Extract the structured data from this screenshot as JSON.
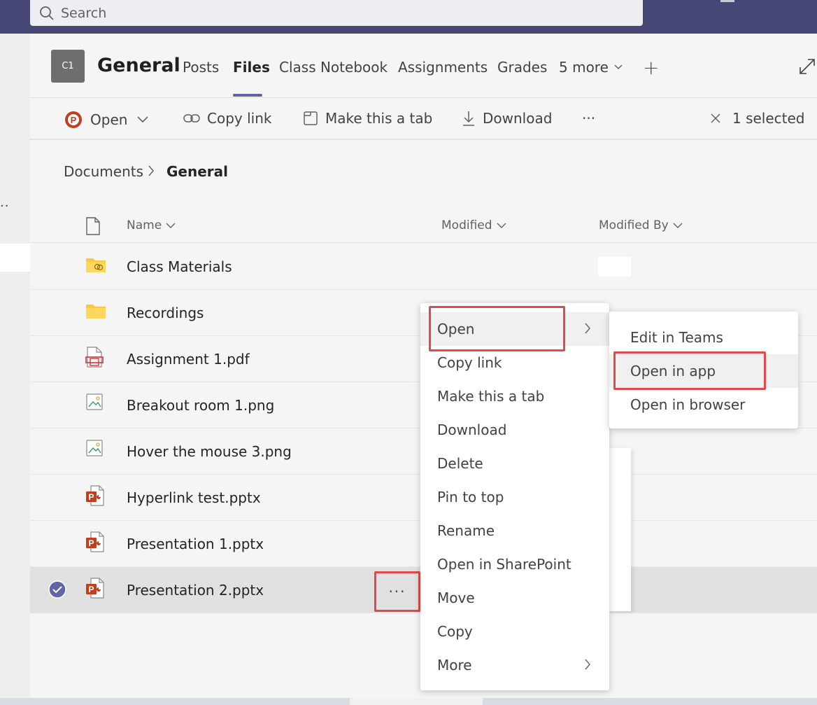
{
  "search": {
    "placeholder": "Search"
  },
  "team": {
    "avatar": "C1",
    "title": "General"
  },
  "tabs": [
    "Posts",
    "Files",
    "Class Notebook",
    "Assignments",
    "Grades",
    "5 more"
  ],
  "toolbar": {
    "open": "Open",
    "copy_link": "Copy link",
    "make_tab": "Make this a tab",
    "download": "Download",
    "more": "···",
    "selected": "1 selected"
  },
  "breadcrumb": {
    "root": "Documents",
    "current": "General"
  },
  "columns": {
    "name": "Name",
    "modified": "Modified",
    "modified_by": "Modified By"
  },
  "files": [
    {
      "name": "Class Materials",
      "icon": "folder-shared-icon"
    },
    {
      "name": "Recordings",
      "icon": "folder-icon"
    },
    {
      "name": "Assignment 1.pdf",
      "icon": "pdf-file-icon"
    },
    {
      "name": "Breakout room 1.png",
      "icon": "image-file-icon"
    },
    {
      "name": "Hover the mouse 3.png",
      "icon": "image-file-icon"
    },
    {
      "name": "Hyperlink test.pptx",
      "icon": "powerpoint-file-icon"
    },
    {
      "name": "Presentation 1.pptx",
      "icon": "powerpoint-file-icon"
    },
    {
      "name": "Presentation 2.pptx",
      "icon": "powerpoint-file-icon",
      "selected": true
    }
  ],
  "row_more": "···",
  "context_menu": [
    "Open",
    "Copy link",
    "Make this a tab",
    "Download",
    "Delete",
    "Pin to top",
    "Rename",
    "Open in SharePoint",
    "Move",
    "Copy",
    "More"
  ],
  "submenu": [
    "Edit in Teams",
    "Open in app",
    "Open in browser"
  ],
  "colors": {
    "brand": "#464775",
    "accent": "#6264a7",
    "highlight": "#e04a4a",
    "powerpoint": "#c43e1c"
  }
}
